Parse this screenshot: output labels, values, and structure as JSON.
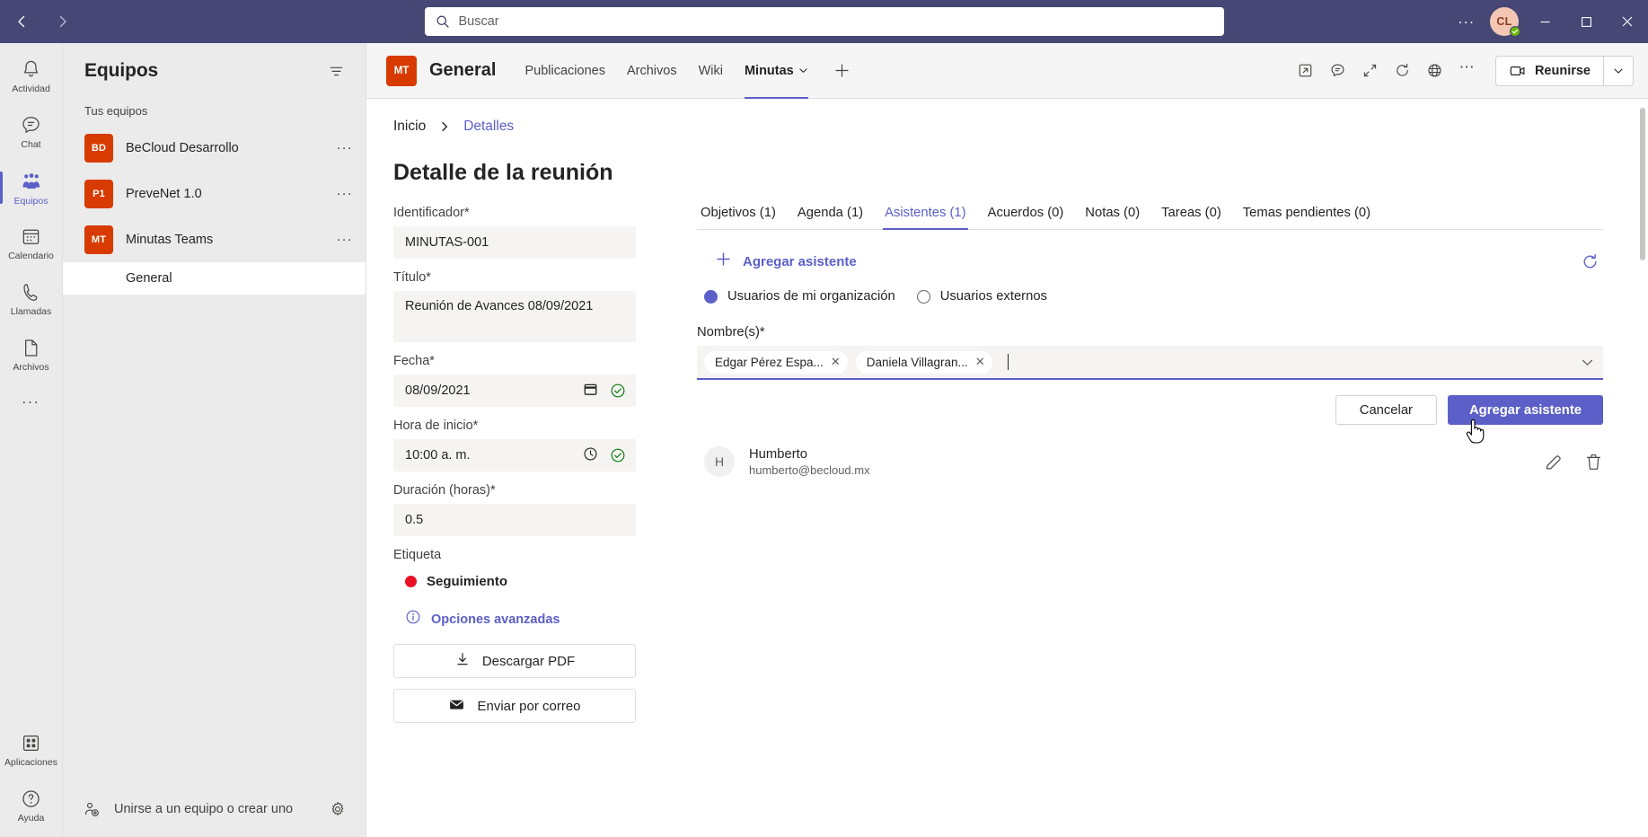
{
  "titlebar": {
    "back_icon": "chevron-left-icon",
    "forward_icon": "chevron-right-icon",
    "search_placeholder": "Buscar",
    "search_value": "",
    "more_label": "...",
    "avatar_initials": "CL",
    "minimize_label": "Minimizar",
    "maximize_label": "Maximizar",
    "close_label": "Cerrar"
  },
  "rail": {
    "items": [
      {
        "label": "Actividad",
        "icon": "bell-icon",
        "active": false
      },
      {
        "label": "Chat",
        "icon": "chat-icon",
        "active": false
      },
      {
        "label": "Equipos",
        "icon": "teams-icon",
        "active": true
      },
      {
        "label": "Calendario",
        "icon": "calendar-icon",
        "active": false
      },
      {
        "label": "Llamadas",
        "icon": "phone-icon",
        "active": false
      },
      {
        "label": "Archivos",
        "icon": "file-icon",
        "active": false
      }
    ],
    "more_label": "...",
    "bottom": [
      {
        "label": "Aplicaciones",
        "icon": "apps-icon"
      },
      {
        "label": "Ayuda",
        "icon": "help-icon"
      }
    ]
  },
  "teams_panel": {
    "title": "Equipos",
    "filter_icon": "filter-icon",
    "section_label": "Tus equipos",
    "teams": [
      {
        "initials": "BD",
        "name": "BeCloud Desarrollo",
        "menu": "..."
      },
      {
        "initials": "P1",
        "name": "PreveNet 1.0",
        "menu": "..."
      },
      {
        "initials": "MT",
        "name": "Minutas Teams",
        "menu": "..."
      }
    ],
    "channels": [
      {
        "name": "General",
        "active": true
      }
    ],
    "footer_label": "Unirse a un equipo o crear uno",
    "footer_icon": "add-people-icon",
    "gear_icon": "gear-icon"
  },
  "channel_header": {
    "team_initials": "MT",
    "channel_name": "General",
    "tabs": [
      {
        "label": "Publicaciones",
        "active": false,
        "caret": false
      },
      {
        "label": "Archivos",
        "active": false,
        "caret": false
      },
      {
        "label": "Wiki",
        "active": false,
        "caret": false
      },
      {
        "label": "Minutas",
        "active": true,
        "caret": true
      }
    ],
    "add_tab_icon": "plus-icon",
    "actions": [
      {
        "icon": "open-in-new-icon",
        "name": "pop-out-button"
      },
      {
        "icon": "conversation-icon",
        "name": "conversation-button"
      },
      {
        "icon": "expand-icon",
        "name": "expand-button"
      },
      {
        "icon": "refresh-icon",
        "name": "refresh-button"
      },
      {
        "icon": "globe-icon",
        "name": "website-button"
      },
      {
        "icon": "ellipsis-icon",
        "name": "more-options-button"
      }
    ],
    "meet_label": "Reunirse",
    "meet_icon": "video-camera-icon",
    "meet_caret_icon": "chevron-down-icon"
  },
  "breadcrumb": {
    "home": "Inicio",
    "separator_icon": "chevron-right-icon",
    "current": "Detalles"
  },
  "page_title": "Detalle de la reunión",
  "form": {
    "fields": [
      {
        "label": "Identificador*",
        "value": "MINUTAS-001",
        "icons": [],
        "tall": false
      },
      {
        "label": "Título*",
        "value": "Reunión  de Avances 08/09/2021",
        "icons": [],
        "tall": true
      },
      {
        "label": "Fecha*",
        "value": "08/09/2021",
        "icons": [
          "calendar-icon",
          "check-circle-icon"
        ],
        "tall": false
      },
      {
        "label": "Hora de inicio*",
        "value": "10:00  a. m.",
        "icons": [
          "clock-icon",
          "check-circle-icon"
        ],
        "tall": false
      },
      {
        "label": "Duración (horas)*",
        "value": "0.5",
        "icons": [],
        "tall": false
      }
    ],
    "tag_label": "Etiqueta",
    "tag_value": "Seguimiento",
    "tag_color": "#e81123",
    "advanced_label": "Opciones avanzadas",
    "advanced_icon": "info-icon",
    "buttons": [
      {
        "label": "Descargar PDF",
        "icon": "download-icon"
      },
      {
        "label": "Enviar por correo",
        "icon": "mail-icon"
      }
    ]
  },
  "detail_tabs": [
    {
      "label": "Objetivos (1)",
      "active": false
    },
    {
      "label": "Agenda (1)",
      "active": false
    },
    {
      "label": "Asistentes (1)",
      "active": true
    },
    {
      "label": "Acuerdos (0)",
      "active": false
    },
    {
      "label": "Notas (0)",
      "active": false
    },
    {
      "label": "Tareas (0)",
      "active": false
    },
    {
      "label": "Temas pendientes (0)",
      "active": false
    }
  ],
  "attendees_panel": {
    "add_label": "Agregar asistente",
    "add_icon": "plus-icon",
    "refresh_icon": "refresh-icon",
    "radios": [
      {
        "label": "Usuarios de mi organización",
        "selected": true
      },
      {
        "label": "Usuarios externos",
        "selected": false
      }
    ],
    "names_label": "Nombre(s)*",
    "chips": [
      {
        "label": "Edgar Pérez Espa...",
        "remove_icon": "close-icon"
      },
      {
        "label": "Daniela Villagran...",
        "remove_icon": "close-icon"
      }
    ],
    "input_value": "",
    "dropdown_icon": "chevron-down-icon",
    "cancel_label": "Cancelar",
    "submit_label": "Agregar asistente",
    "accent_color": "#5b5fc7",
    "list": [
      {
        "initial": "H",
        "name": "Humberto",
        "email": "humberto@becloud.mx",
        "edit_icon": "pencil-icon",
        "delete_icon": "trash-icon"
      }
    ]
  }
}
